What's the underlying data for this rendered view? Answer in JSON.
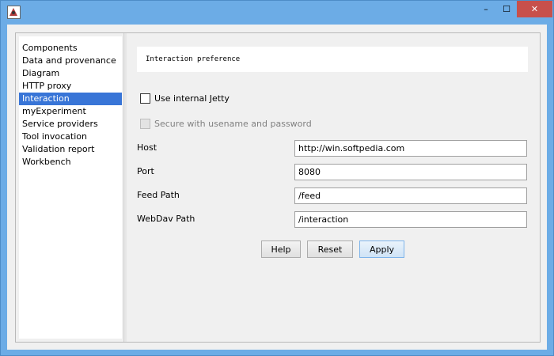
{
  "window": {
    "minimize_glyph": "–",
    "maximize_glyph": "☐",
    "close_glyph": "✕"
  },
  "tree": {
    "items": [
      {
        "label": "Components",
        "selected": false
      },
      {
        "label": "Data and provenance",
        "selected": false
      },
      {
        "label": "Diagram",
        "selected": false
      },
      {
        "label": "HTTP proxy",
        "selected": false
      },
      {
        "label": "Interaction",
        "selected": true
      },
      {
        "label": "myExperiment",
        "selected": false
      },
      {
        "label": "Service providers",
        "selected": false
      },
      {
        "label": "Tool invocation",
        "selected": false
      },
      {
        "label": "Validation report",
        "selected": false
      },
      {
        "label": "Workbench",
        "selected": false
      }
    ]
  },
  "form": {
    "title": "Interaction preference",
    "use_internal_jetty": {
      "label": "Use internal Jetty",
      "checked": false
    },
    "secure": {
      "label": "Secure with usename and password",
      "checked": false,
      "enabled": false
    },
    "host": {
      "label": "Host",
      "value": "http://win.softpedia.com"
    },
    "port": {
      "label": "Port",
      "value": "8080"
    },
    "feed_path": {
      "label": "Feed Path",
      "value": "/feed"
    },
    "webdav_path": {
      "label": "WebDav Path",
      "value": "/interaction"
    }
  },
  "buttons": {
    "help": "Help",
    "reset": "Reset",
    "apply": "Apply"
  },
  "colors": {
    "selection": "#3875d7",
    "close_button": "#c7504b",
    "window_frame": "#6cace6"
  }
}
